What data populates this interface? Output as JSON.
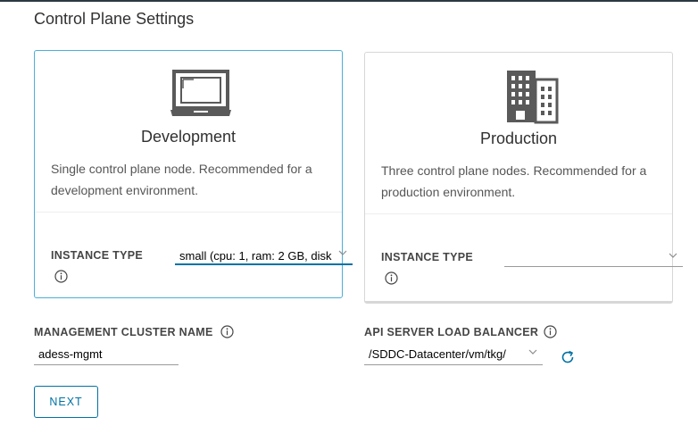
{
  "page": {
    "title": "Control Plane Settings"
  },
  "cards": {
    "development": {
      "icon": "laptop-icon",
      "name": "Development",
      "description": "Single control plane node. Recommended for a development environment.",
      "instance_type_label": "INSTANCE TYPE",
      "instance_type_value": "small (cpu: 1, ram: 2 GB, disk",
      "selected": true
    },
    "production": {
      "icon": "building-icon",
      "name": "Production",
      "description": "Three control plane nodes. Recommended for a production environment.",
      "instance_type_label": "INSTANCE TYPE",
      "instance_type_value": "",
      "selected": false
    }
  },
  "fields": {
    "cluster_name_label": "MANAGEMENT CLUSTER NAME",
    "cluster_name_value": "adess-mgmt",
    "load_balancer_label": "API SERVER LOAD BALANCER",
    "load_balancer_value": "/SDDC-Datacenter/vm/tkg/"
  },
  "buttons": {
    "next_label": "NEXT"
  },
  "colors": {
    "accent": "#0072a3",
    "selected_border": "#49afd9",
    "text": "#313131",
    "muted": "#565656"
  }
}
